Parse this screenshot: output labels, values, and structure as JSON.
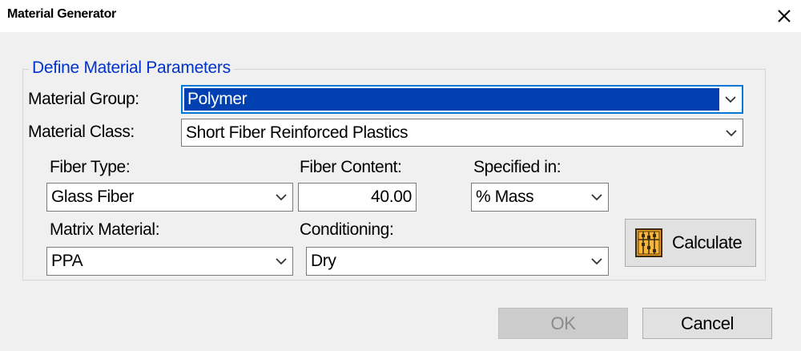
{
  "window": {
    "title": "Material Generator",
    "close_glyph": "✕"
  },
  "group": {
    "legend": "Define Material Parameters"
  },
  "fields": {
    "material_group": {
      "label": "Material Group:",
      "value": "Polymer"
    },
    "material_class": {
      "label": "Material Class:",
      "value": "Short Fiber Reinforced Plastics"
    },
    "fiber_type": {
      "label": "Fiber Type:",
      "value": "Glass Fiber"
    },
    "fiber_content": {
      "label": "Fiber Content:",
      "value": "40.00"
    },
    "specified_in": {
      "label": "Specified in:",
      "value": "% Mass"
    },
    "matrix_material": {
      "label": "Matrix Material:",
      "value": "PPA"
    },
    "conditioning": {
      "label": "Conditioning:",
      "value": "Dry"
    }
  },
  "buttons": {
    "calculate": "Calculate",
    "ok": "OK",
    "cancel": "Cancel"
  },
  "icons": {
    "calculate": "abacus-icon",
    "dropdown": "chevron-down-icon",
    "close": "close-icon"
  },
  "colors": {
    "legend_text": "#0033cc",
    "selection": "#0040b0",
    "focus_border": "#0078d7",
    "dialog_bg": "#f0f0f0",
    "icon_orange": "#f0a020"
  }
}
